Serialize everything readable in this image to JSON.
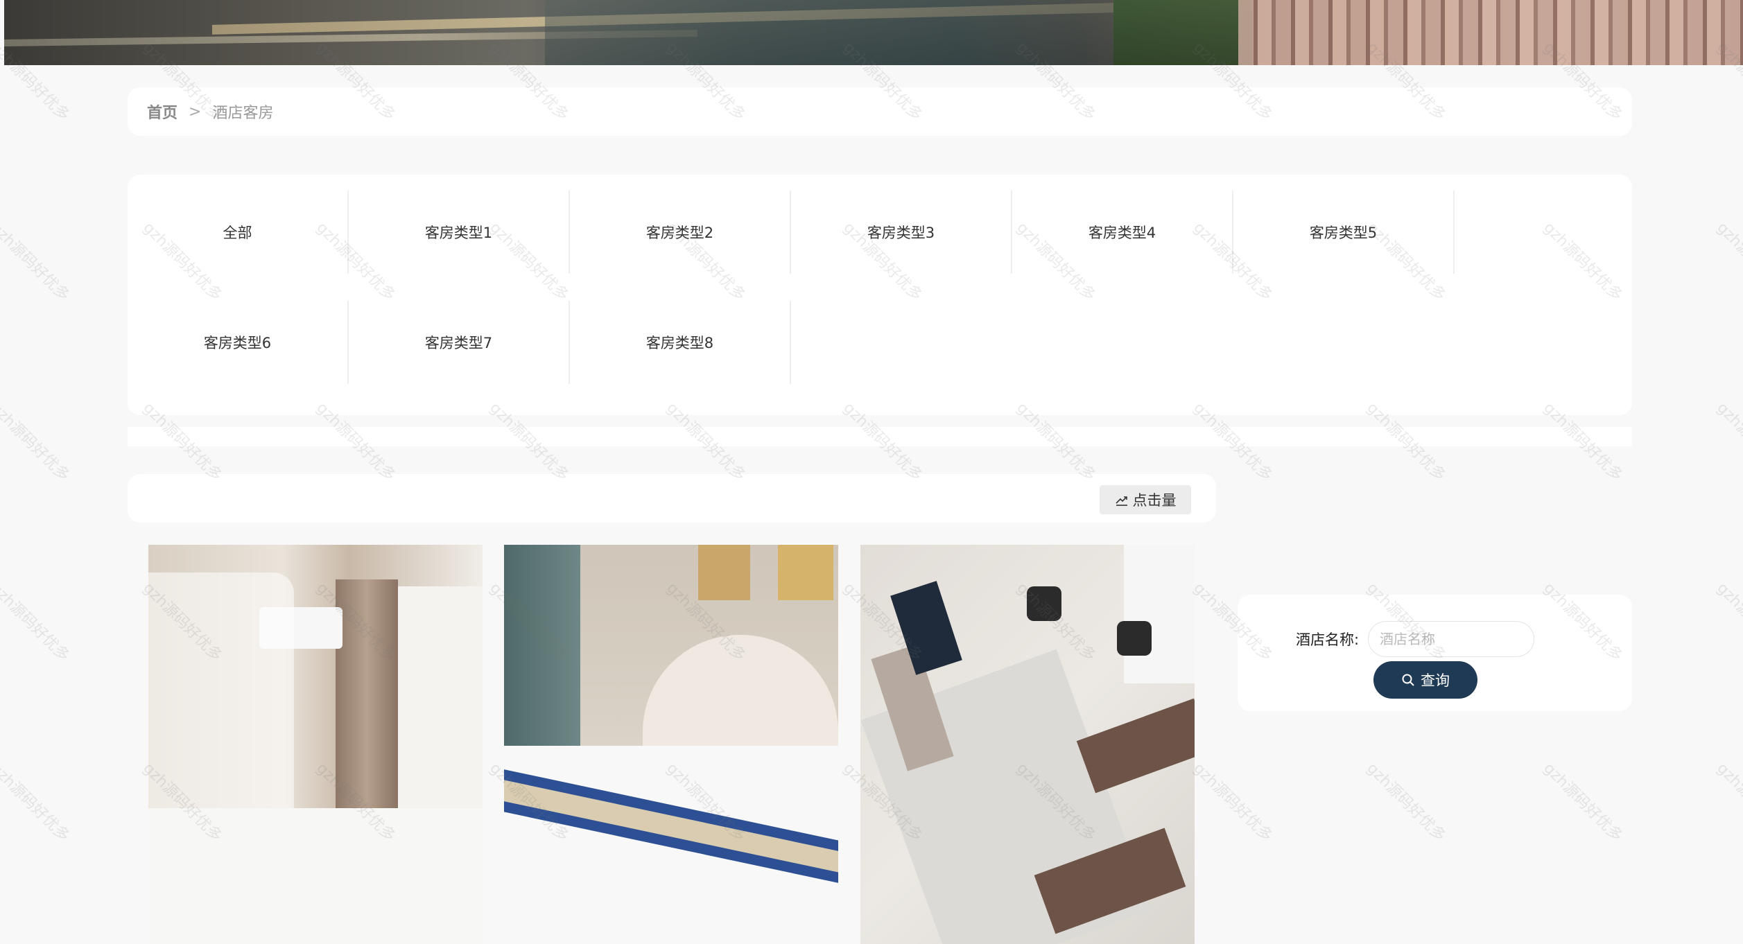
{
  "breadcrumb": {
    "home": "首页",
    "separator": ">",
    "current": "酒店客房"
  },
  "room_types": [
    "全部",
    "客房类型1",
    "客房类型2",
    "客房类型3",
    "客房类型4",
    "客房类型5",
    "客房类型6",
    "客房类型7",
    "客房类型8"
  ],
  "sort": {
    "label": "点击量",
    "icon": "trend-chart-icon"
  },
  "search": {
    "label": "酒店名称:",
    "placeholder": "酒店名称",
    "button": "查询",
    "button_icon": "search-icon",
    "button_color": "#1f3a55"
  },
  "watermark": "gzh源码好优多"
}
